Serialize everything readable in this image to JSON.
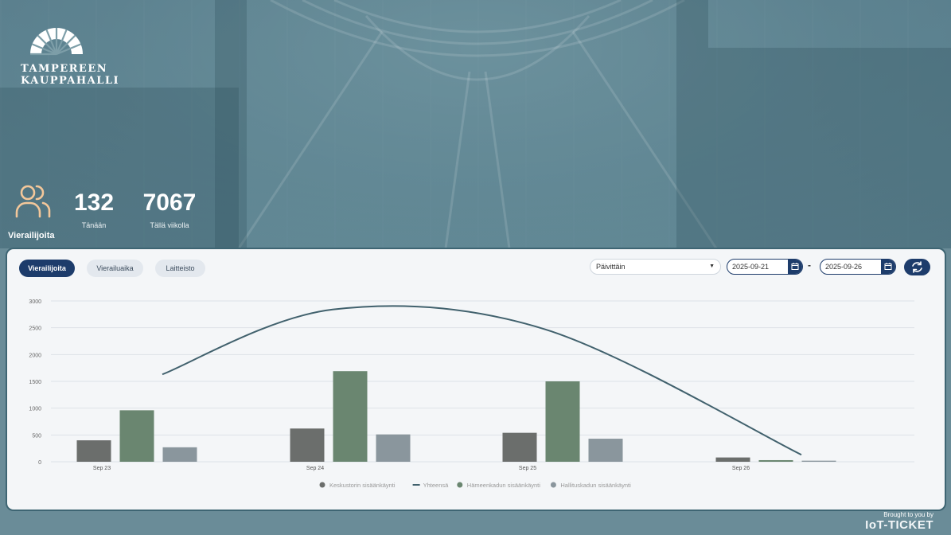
{
  "brand": {
    "line1": "TAMPEREEN",
    "line2": "KAUPPAHALLI"
  },
  "visitors": {
    "label": "Vierailijoita",
    "icon": "users-icon",
    "today": {
      "value": "132",
      "label": "Tänään"
    },
    "week": {
      "value": "7067",
      "label": "Tällä viikolla"
    }
  },
  "tabs": [
    {
      "label": "Vierailijoita",
      "active": true
    },
    {
      "label": "Vierailuaika",
      "active": false
    },
    {
      "label": "Laitteisto",
      "active": false
    }
  ],
  "interval": {
    "selected": "Päivittäin"
  },
  "date_range": {
    "start": "2025-09-21",
    "end": "2025-09-26",
    "separator": "-"
  },
  "footer": {
    "brought": "Brought to you by",
    "brand": "IoT-TICKET"
  },
  "colors": {
    "accent": "#1d3c6b",
    "series1": "#6b6e6c",
    "series2": "#6a8670",
    "series3": "#8a969d",
    "total_line": "#41616d"
  },
  "chart_data": {
    "type": "bar",
    "categories": [
      "Sep 23",
      "Sep 24",
      "Sep 25",
      "Sep 26"
    ],
    "ylim": [
      0,
      3000
    ],
    "yticks": [
      0,
      500,
      1000,
      1500,
      2000,
      2500,
      3000
    ],
    "series": [
      {
        "name": "Keskustorin sisäänkäynti",
        "kind": "bar",
        "values": [
          400,
          620,
          540,
          80
        ]
      },
      {
        "name": "Yhteensä",
        "kind": "line",
        "values": [
          1630,
          2840,
          2470,
          130
        ]
      },
      {
        "name": "Hämeenkadun sisäänkäynti",
        "kind": "bar",
        "values": [
          960,
          1690,
          1500,
          30
        ]
      },
      {
        "name": "Hallituskadun sisäänkäynti",
        "kind": "bar",
        "values": [
          270,
          510,
          430,
          20
        ]
      }
    ],
    "legend_position": "bottom",
    "grid": true
  }
}
